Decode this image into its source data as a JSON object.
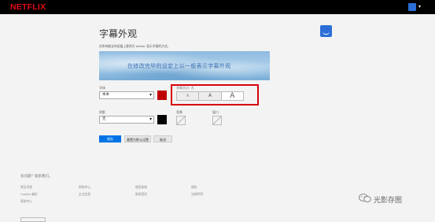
{
  "header": {
    "logo": "NETFLIX",
    "caret": "▾"
  },
  "page": {
    "title": "字幕外观",
    "description": "在所有能支持设备上更改为 esther 显示字幕的方式。",
    "preview_text": "在修改完毕的设定上以一般表示字幕外观"
  },
  "font": {
    "label": "字体",
    "value": "本本",
    "color": "#c00000"
  },
  "shadow": {
    "label": "阴影",
    "value": "无",
    "color": "#000000"
  },
  "text_size": {
    "label": "字体大小: 大",
    "options": [
      "A",
      "A",
      "A"
    ],
    "selected": "A"
  },
  "background": {
    "label": "背景"
  },
  "window": {
    "label": "窗口"
  },
  "buttons": {
    "save": "保存",
    "reset": "重置为默认设置",
    "cancel": "取消"
  },
  "footer": {
    "question": "有问题？联系我们。",
    "links": [
      "常见问答",
      "帮助中心",
      "使用条款",
      "隐私",
      "Cookie 偏好",
      "企业信息",
      "联系我们",
      "法律声明",
      "帮助中心"
    ]
  },
  "watermark": {
    "text": "光影存图"
  },
  "colors": {
    "accent": "#0073e6",
    "brand": "#e50914",
    "highlight": "#d9000d"
  }
}
